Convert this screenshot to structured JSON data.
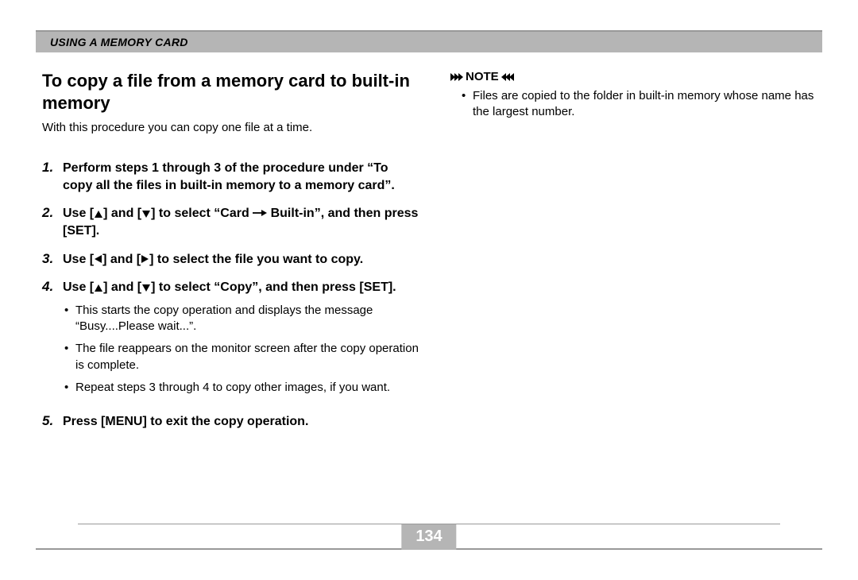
{
  "header": {
    "title": "USING A MEMORY CARD"
  },
  "left": {
    "title": "To copy a file from a memory card to built-in memory",
    "intro": "With this procedure you can copy one file at a time.",
    "steps": [
      {
        "num": "1.",
        "text_before": "Perform steps 1 through 3 of the procedure under “To copy all the files in built-in memory to a memory card”."
      },
      {
        "num": "2.",
        "seg1": "Use [",
        "seg2": "] and [",
        "seg3": "] to select “Card ",
        "seg4": " Built-in”, and then press [SET]."
      },
      {
        "num": "3.",
        "seg1": "Use [",
        "seg2": "] and [",
        "seg3": "] to select the file you want to copy."
      },
      {
        "num": "4.",
        "seg1": "Use [",
        "seg2": "] and [",
        "seg3": "] to select “Copy”, and then press [SET].",
        "sub": [
          "This starts the copy operation and displays the message “Busy....Please wait...”.",
          "The file reappears on the monitor screen after the copy operation is complete.",
          "Repeat steps 3 through 4 to copy other images, if you want."
        ]
      },
      {
        "num": "5.",
        "text_before": "Press [MENU] to exit the copy operation."
      }
    ]
  },
  "right": {
    "note_label": "NOTE",
    "note_items": [
      "Files are copied to the folder in built-in memory whose name has the largest number."
    ]
  },
  "page_number": "134"
}
